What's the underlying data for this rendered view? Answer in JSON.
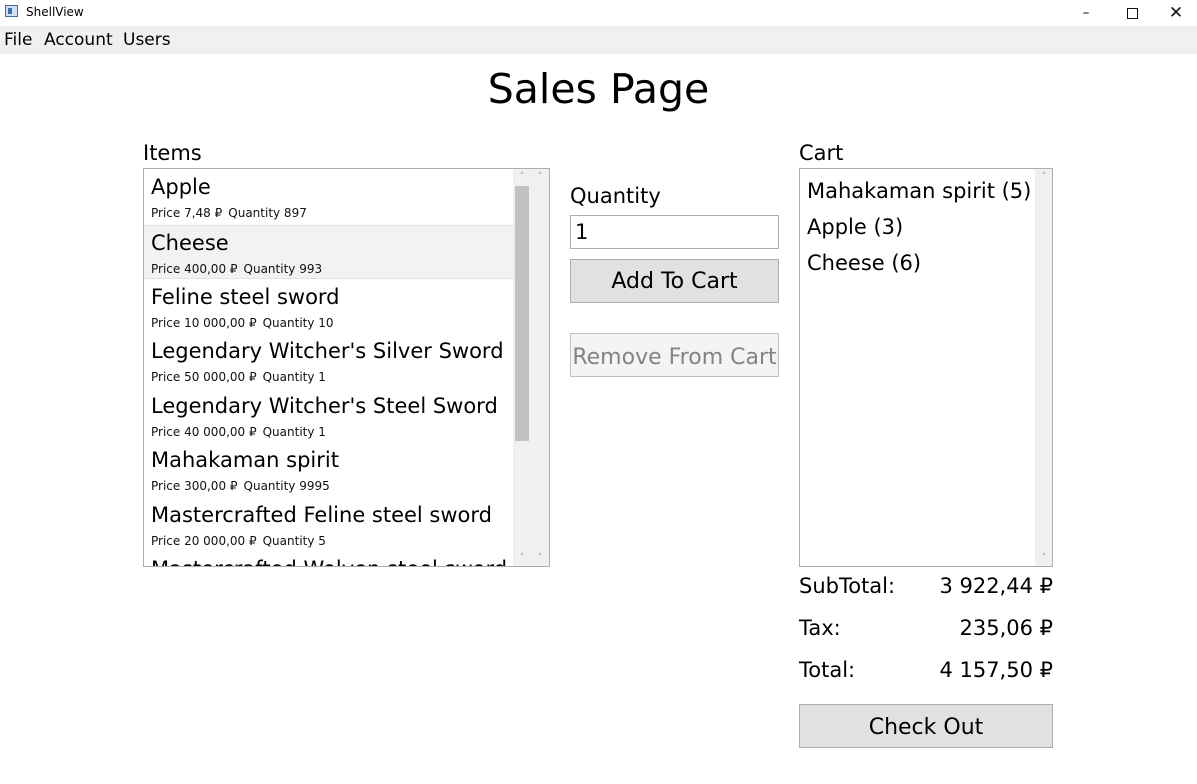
{
  "window": {
    "title": "ShellView",
    "minimize_icon": "minimize-icon",
    "maximize_icon": "maximize-icon",
    "close_icon": "close-icon"
  },
  "menu": {
    "file": "File",
    "account": "Account",
    "users": "Users"
  },
  "page": {
    "title": "Sales Page"
  },
  "items": {
    "label": "Items",
    "list": [
      {
        "name": "Apple",
        "price": "Price 7,48 ₽",
        "quantity": "Quantity 897"
      },
      {
        "name": "Cheese",
        "price": "Price 400,00 ₽",
        "quantity": "Quantity 993"
      },
      {
        "name": "Feline steel sword",
        "price": "Price 10 000,00 ₽",
        "quantity": "Quantity 10"
      },
      {
        "name": "Legendary Witcher's Silver Sword",
        "price": "Price 50 000,00 ₽",
        "quantity": "Quantity 1"
      },
      {
        "name": "Legendary Witcher's Steel Sword",
        "price": "Price 40 000,00 ₽",
        "quantity": "Quantity 1"
      },
      {
        "name": "Mahakaman spirit",
        "price": "Price 300,00 ₽",
        "quantity": "Quantity 9995"
      },
      {
        "name": "Mastercrafted Feline steel sword",
        "price": "Price 20 000,00 ₽",
        "quantity": "Quantity 5"
      },
      {
        "name": "Mastercrafted Wolven steel sword",
        "price": "",
        "quantity": ""
      }
    ],
    "selected_index": 1
  },
  "quantity": {
    "label": "Quantity",
    "value": "1"
  },
  "buttons": {
    "add_to_cart": "Add To Cart",
    "remove_from_cart": "Remove From Cart",
    "check_out": "Check Out"
  },
  "cart": {
    "label": "Cart",
    "list": [
      "Mahakaman spirit (5)",
      "Apple (3)",
      "Cheese (6)"
    ]
  },
  "totals": {
    "subtotal_label": "SubTotal:",
    "subtotal": "3 922,44 ₽",
    "tax_label": "Tax:",
    "tax": "235,06 ₽",
    "total_label": "Total:",
    "total": "4 157,50 ₽"
  },
  "colors": {
    "menubar_bg": "#f0f0f0",
    "button_bg": "#e1e1e1",
    "selected_row_bg": "#f2f2f2"
  }
}
